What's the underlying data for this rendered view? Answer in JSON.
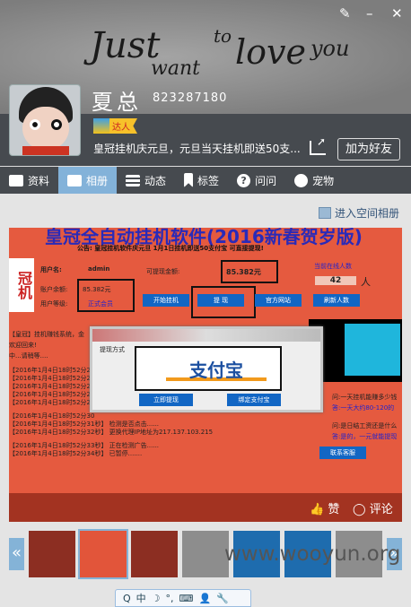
{
  "window": {
    "controls": [
      "skin",
      "minimize",
      "close"
    ]
  },
  "cover": {
    "words": [
      "Just",
      "to",
      "love",
      "you",
      "want"
    ]
  },
  "profile": {
    "name": "夏总",
    "qq": "823287180",
    "badge": "达人",
    "signature": "皇冠挂机庆元旦，元旦当天挂机即送50支...",
    "add_friend": "加为好友"
  },
  "tabs": [
    {
      "label": "资料",
      "icon": "profile-card-icon"
    },
    {
      "label": "相册",
      "icon": "photo-album-icon",
      "active": true
    },
    {
      "label": "动态",
      "icon": "feed-list-icon"
    },
    {
      "label": "标签",
      "icon": "bookmark-icon"
    },
    {
      "label": "问问",
      "icon": "question-icon"
    },
    {
      "label": "宠物",
      "icon": "pet-icon"
    }
  ],
  "album": {
    "enter_label": "进入空间相册",
    "like": "赞",
    "comment": "评论"
  },
  "photo": {
    "title": "皇冠全自动挂机软件(2016新春贺岁版)",
    "notice": "公告: 皇冠挂机软件庆元旦  1月1日挂机即送50支付宝 可直接提现!",
    "logo": "冠机",
    "username_label": "用户名:",
    "username": "admin",
    "balance_label": "账户余额:",
    "balance": "85.382元",
    "level_label": "用户等级:",
    "level": "正式会员",
    "withdrawable_label": "可提现金额:",
    "withdrawable": "85.382元",
    "online_label": "当前在线人数",
    "online": "42",
    "online_unit": "人",
    "buttons": [
      "开始挂机",
      "提 现",
      "官方网站",
      "刷新人数",
      "联系客服"
    ],
    "log": [
      "【皇冠】挂机赚钱系统，金",
      "欢迎回来!",
      "中...请稍等....",
      "【2016年1月4日18时52分25",
      "【2016年1月4日18时52分26",
      "【2016年1月4日18时52分27",
      "【2016年1月4日18时52分28",
      "【2016年1月4日18时52分29",
      "【2016年1月4日18时52分30",
      "【2016年1月4日18时52分31秒】  检测是否点击......",
      "【2016年1月4日18时52分32秒】  更换代理IP地址为217.137.103.215",
      "【2016年1月4日18时52分33秒】  正在检测广告......",
      "【2016年1月4日18时52分34秒】  已暂停......."
    ],
    "faq": [
      "问:一天挂机能赚多少钱",
      "答:一天大约80-120的",
      "问:是日结工资还是什么",
      "答:是的，一元就能提现"
    ],
    "dialog": {
      "group": "提现方式",
      "brand": "支付宝",
      "btn1": "立即提现",
      "btn2": "绑定支付宝"
    }
  },
  "thumbs": {
    "count_visible": 7,
    "prev": "«",
    "next": "»"
  },
  "ime": {
    "items": [
      "Q",
      "中",
      "☽",
      "°,",
      "⌨",
      "👤",
      "🔧"
    ]
  },
  "watermark": "www.wooyun.org"
}
